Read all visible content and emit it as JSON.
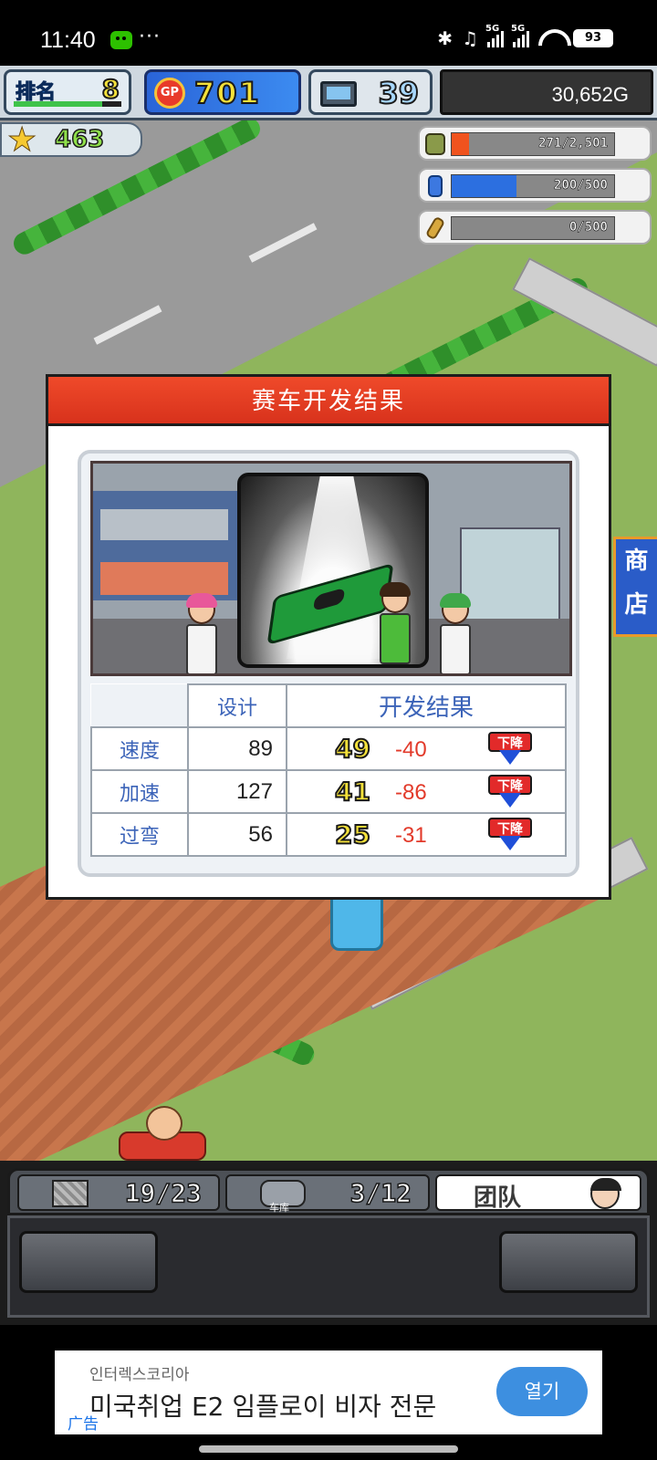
{
  "status_bar": {
    "time": "11:40",
    "more": "···",
    "network1": "5G",
    "network2": "5G",
    "battery": "93",
    "icons": [
      "wechat-icon",
      "bluetooth-icon",
      "earbuds-icon",
      "signal-icon",
      "wifi-icon",
      "battery-icon"
    ]
  },
  "hud": {
    "rank_label": "排名",
    "rank_value": "8",
    "gp_label": "GP",
    "gp_value": "701",
    "research_value": "39",
    "money": "30,652G",
    "stars": "463",
    "resources": [
      {
        "name": "oil",
        "icon": "oil-barrel-icon",
        "text": "271/2,501",
        "fill": 0.108,
        "color": "#f0531e"
      },
      {
        "name": "water",
        "icon": "bottle-icon",
        "text": "200/500",
        "fill": 0.4,
        "color": "#2c6fe0"
      },
      {
        "name": "wheat",
        "icon": "wheat-icon",
        "text": "0/500",
        "fill": 0.0,
        "color": "#d2a23a"
      }
    ]
  },
  "shop_sign": [
    "商",
    "店"
  ],
  "dialog": {
    "title": "赛车开发结果",
    "table": {
      "headers": [
        "设计",
        "开发结果"
      ],
      "rows": [
        {
          "stat": "速度",
          "design": "89",
          "result": "49",
          "diff": "-40",
          "badge": "下降"
        },
        {
          "stat": "加速",
          "design": "127",
          "result": "41",
          "diff": "-86",
          "badge": "下降"
        },
        {
          "stat": "过弯",
          "design": "56",
          "result": "25",
          "diff": "-31",
          "badge": "下降"
        }
      ]
    }
  },
  "bottom_hud": {
    "boxes": "19/23",
    "garage_label": "车库",
    "garage": "3/12",
    "team_label": "团队"
  },
  "ad": {
    "sponsor": "인터렉스코리아",
    "headline": "미국취업 E2 임플로이 비자 전문",
    "label": "广告",
    "open_button": "열기"
  }
}
